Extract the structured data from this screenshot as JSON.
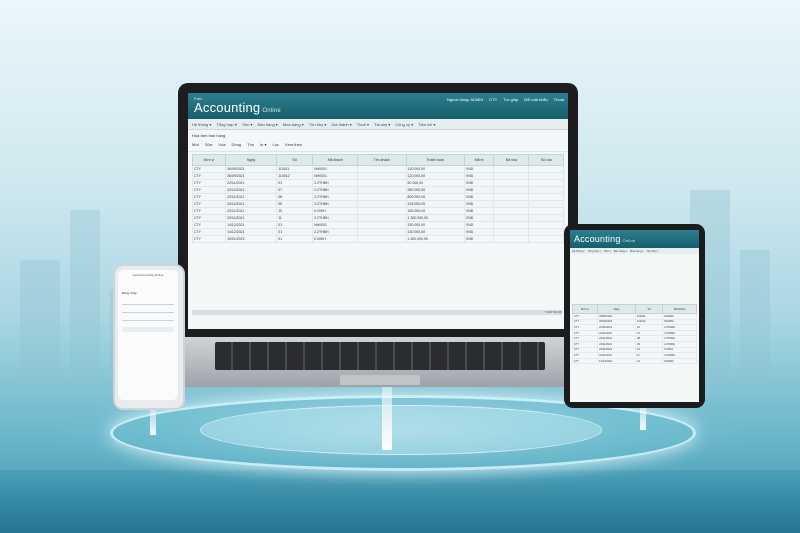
{
  "laptop_app": {
    "brand_top": "Fast",
    "brand": "Accounting",
    "brand_sub": "Online",
    "header_links": [
      "Người dùng: ADMIN",
      "CTY",
      "Trợ giúp",
      "Đổi mật khẩu",
      "Thoát"
    ],
    "menu": [
      "Hệ thống ▾",
      "Tổng hợp ▾",
      "Tiền ▾",
      "Bán hàng ▾",
      "Mua hàng ▾",
      "Tồn kho ▾",
      "Giá thành ▾",
      "Thuế ▾",
      "Tài sản ▾",
      "Công cụ ▾",
      "Tiện ích ▾"
    ],
    "breadcrumb": "Hóa đơn bán hàng",
    "toolbar": [
      "Mới",
      "Sửa",
      "Xóa",
      "Dòng",
      "Tìm",
      "In ▾",
      "Lọc",
      "Xem theo"
    ],
    "columns": [
      "Đơn vị",
      "Ngày",
      "Số",
      "Mã khách",
      "Tên khách",
      "Thành toán",
      "Mã nt",
      "Đã xóa",
      "Số xóa"
    ],
    "rows": [
      [
        "CTY",
        "26/09/2021",
        "110011",
        "NH0001",
        "",
        "120 000,00",
        "VND",
        "",
        ""
      ],
      [
        "CTY",
        "26/09/2021",
        "110012",
        "NH0001",
        "",
        "120 000,00",
        "VND",
        "",
        ""
      ],
      [
        "CTY",
        "22/11/2021",
        "01",
        "2.2THBH",
        "",
        "50 000,00",
        "VND",
        "",
        ""
      ],
      [
        "CTY",
        "22/11/2021",
        "07",
        "2.2THBH",
        "",
        "350 000,00",
        "VND",
        "",
        ""
      ],
      [
        "CTY",
        "22/11/2021",
        "08",
        "2.2THBH",
        "",
        "800 000,00",
        "VND",
        "",
        ""
      ],
      [
        "CTY",
        "22/11/2021",
        "09",
        "2.2THBH",
        "",
        "125 000,00",
        "VND",
        "",
        ""
      ],
      [
        "CTY",
        "22/11/2021",
        "10",
        "0.00KH",
        "",
        "160 000,00",
        "VND",
        "",
        ""
      ],
      [
        "CTY",
        "22/11/2021",
        "11",
        "2.2THBH",
        "",
        "1 300 000,00",
        "VND",
        "",
        ""
      ],
      [
        "CTY",
        "14/12/2021",
        "01",
        "NH0001",
        "",
        "130 000,00",
        "VND",
        "",
        ""
      ],
      [
        "CTY",
        "14/12/2021",
        "01",
        "2.2THBH",
        "",
        "130 000,00",
        "VND",
        "",
        ""
      ],
      [
        "CTY",
        "15/01/2022",
        "01",
        "0.00KH",
        "",
        "1 500 000,00",
        "VND",
        "",
        ""
      ]
    ],
    "total": "7 910 500,00"
  },
  "tablet_app": {
    "brand": "Accounting",
    "brand_sub": "Online",
    "menu": [
      "Hệ thống ▾",
      "Tổng hợp ▾",
      "Tiền ▾",
      "Bán hàng ▾",
      "Mua hàng ▾",
      "Tồn kho ▾"
    ],
    "columns": [
      "Đơn vị",
      "Ngày",
      "Số",
      "Mã khách"
    ],
    "rows": [
      [
        "CTY",
        "26/09/2021",
        "110011",
        "NH0001"
      ],
      [
        "CTY",
        "26/09/2021",
        "110012",
        "NH0001"
      ],
      [
        "CTY",
        "22/11/2021",
        "01",
        "2.2THBH"
      ],
      [
        "CTY",
        "22/11/2021",
        "07",
        "2.2THBH"
      ],
      [
        "CTY",
        "22/11/2021",
        "08",
        "2.2THBH"
      ],
      [
        "CTY",
        "22/11/2021",
        "09",
        "2.2THBH"
      ],
      [
        "CTY",
        "22/11/2021",
        "10",
        "0.00KH"
      ],
      [
        "CTY",
        "22/11/2021",
        "11",
        "2.2THBH"
      ],
      [
        "CTY",
        "14/12/2021",
        "01",
        "NH0001"
      ]
    ]
  },
  "phone_app": {
    "title": "Fast Accounting Online",
    "label": "Đăng nhập"
  },
  "colors": {
    "header": "#1f6f7e",
    "accent": "#2c7f8f",
    "background": "#cfe8ef"
  }
}
